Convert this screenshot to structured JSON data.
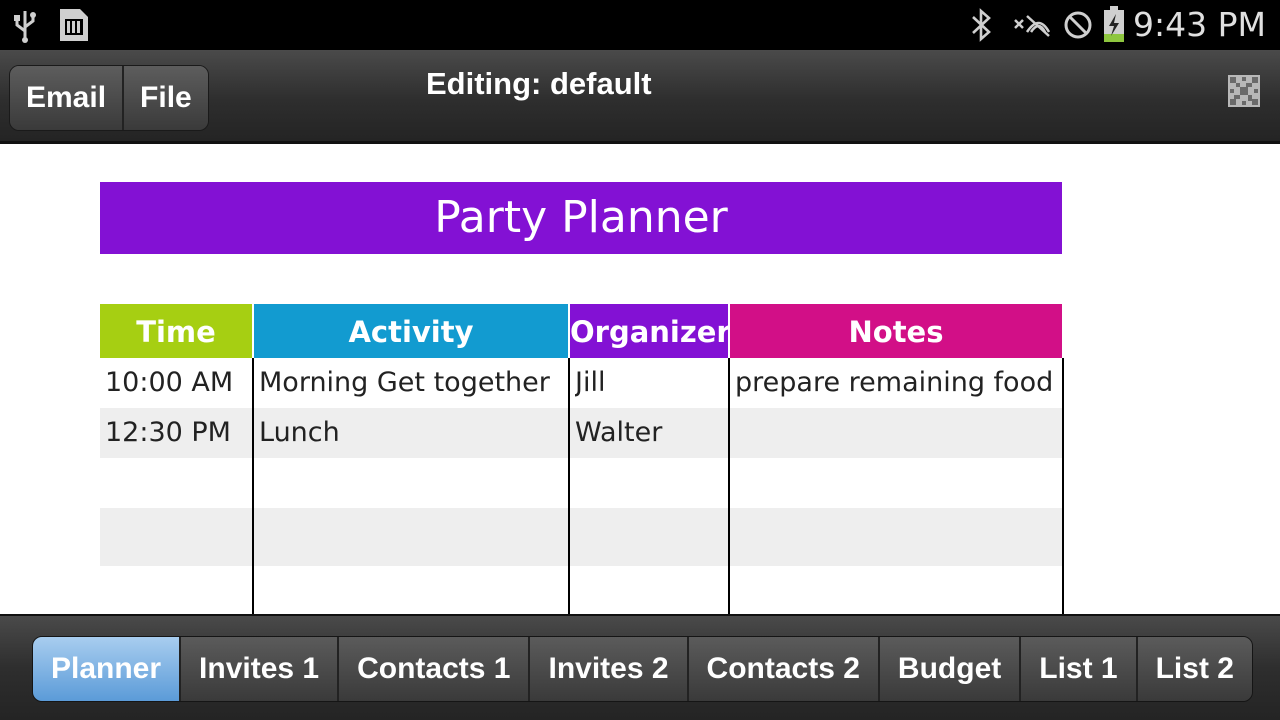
{
  "status_bar": {
    "time": "9:43 PM",
    "icons": [
      "usb-icon",
      "sd-card-icon",
      "bluetooth-icon",
      "no-signal-icon",
      "do-not-disturb-icon",
      "battery-charging-icon"
    ]
  },
  "action_bar": {
    "email_label": "Email",
    "file_label": "File",
    "title": "Editing: default",
    "overflow_icon": "grid-icon"
  },
  "planner": {
    "title": "Party Planner",
    "colors": {
      "title": "#8311d4",
      "time": "#a6cf12",
      "activity": "#129bd0",
      "organizer": "#8311d4",
      "notes": "#d20f87"
    },
    "headers": {
      "time": "Time",
      "activity": "Activity",
      "organizer": "Organizer",
      "notes": "Notes"
    },
    "rows": [
      {
        "time": "10:00 AM",
        "activity": "Morning Get together",
        "organizer": "Jill",
        "notes": "prepare remaining food"
      },
      {
        "time": "12:30 PM",
        "activity": "Lunch",
        "organizer": "Walter",
        "notes": ""
      },
      {
        "time": "",
        "activity": "",
        "organizer": "",
        "notes": ""
      },
      {
        "time": "",
        "activity": "",
        "organizer": "",
        "notes": ""
      },
      {
        "time": "",
        "activity": "",
        "organizer": "",
        "notes": ""
      }
    ]
  },
  "tabs": [
    {
      "label": "Planner",
      "active": true
    },
    {
      "label": "Invites 1",
      "active": false
    },
    {
      "label": "Contacts 1",
      "active": false
    },
    {
      "label": "Invites 2",
      "active": false
    },
    {
      "label": "Contacts 2",
      "active": false
    },
    {
      "label": "Budget",
      "active": false
    },
    {
      "label": "List 1",
      "active": false
    },
    {
      "label": "List 2",
      "active": false
    }
  ]
}
